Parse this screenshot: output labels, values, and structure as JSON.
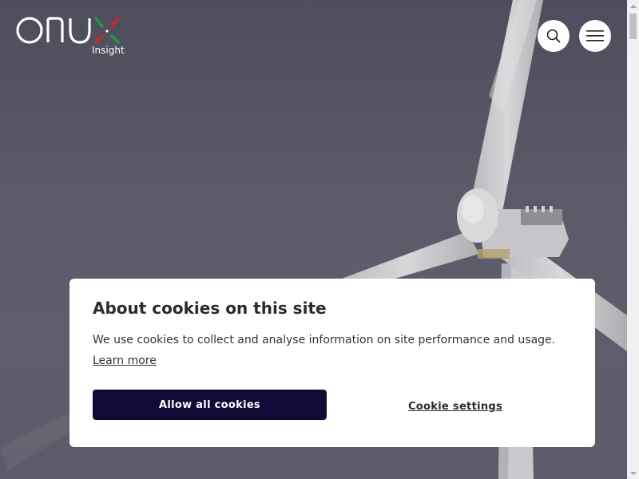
{
  "header": {
    "logo": {
      "word": "ONYX",
      "subtitle": "Insight",
      "colors": {
        "text": "#ffffff",
        "x_green": "#1e9b4a",
        "x_red": "#d3232a"
      }
    },
    "search_icon": "search-icon",
    "menu_icon": "hamburger-menu-icon"
  },
  "cookie_banner": {
    "title": "About cookies on this site",
    "body": "We use cookies to collect and analyse information on site performance and usage.",
    "learn_more": "Learn more",
    "allow_all_label": "Allow all cookies",
    "settings_label": "Cookie settings",
    "colors": {
      "allow_button_bg": "#110a36",
      "card_bg": "#ffffff"
    }
  },
  "hero": {
    "overlay_color": "#55545f"
  }
}
